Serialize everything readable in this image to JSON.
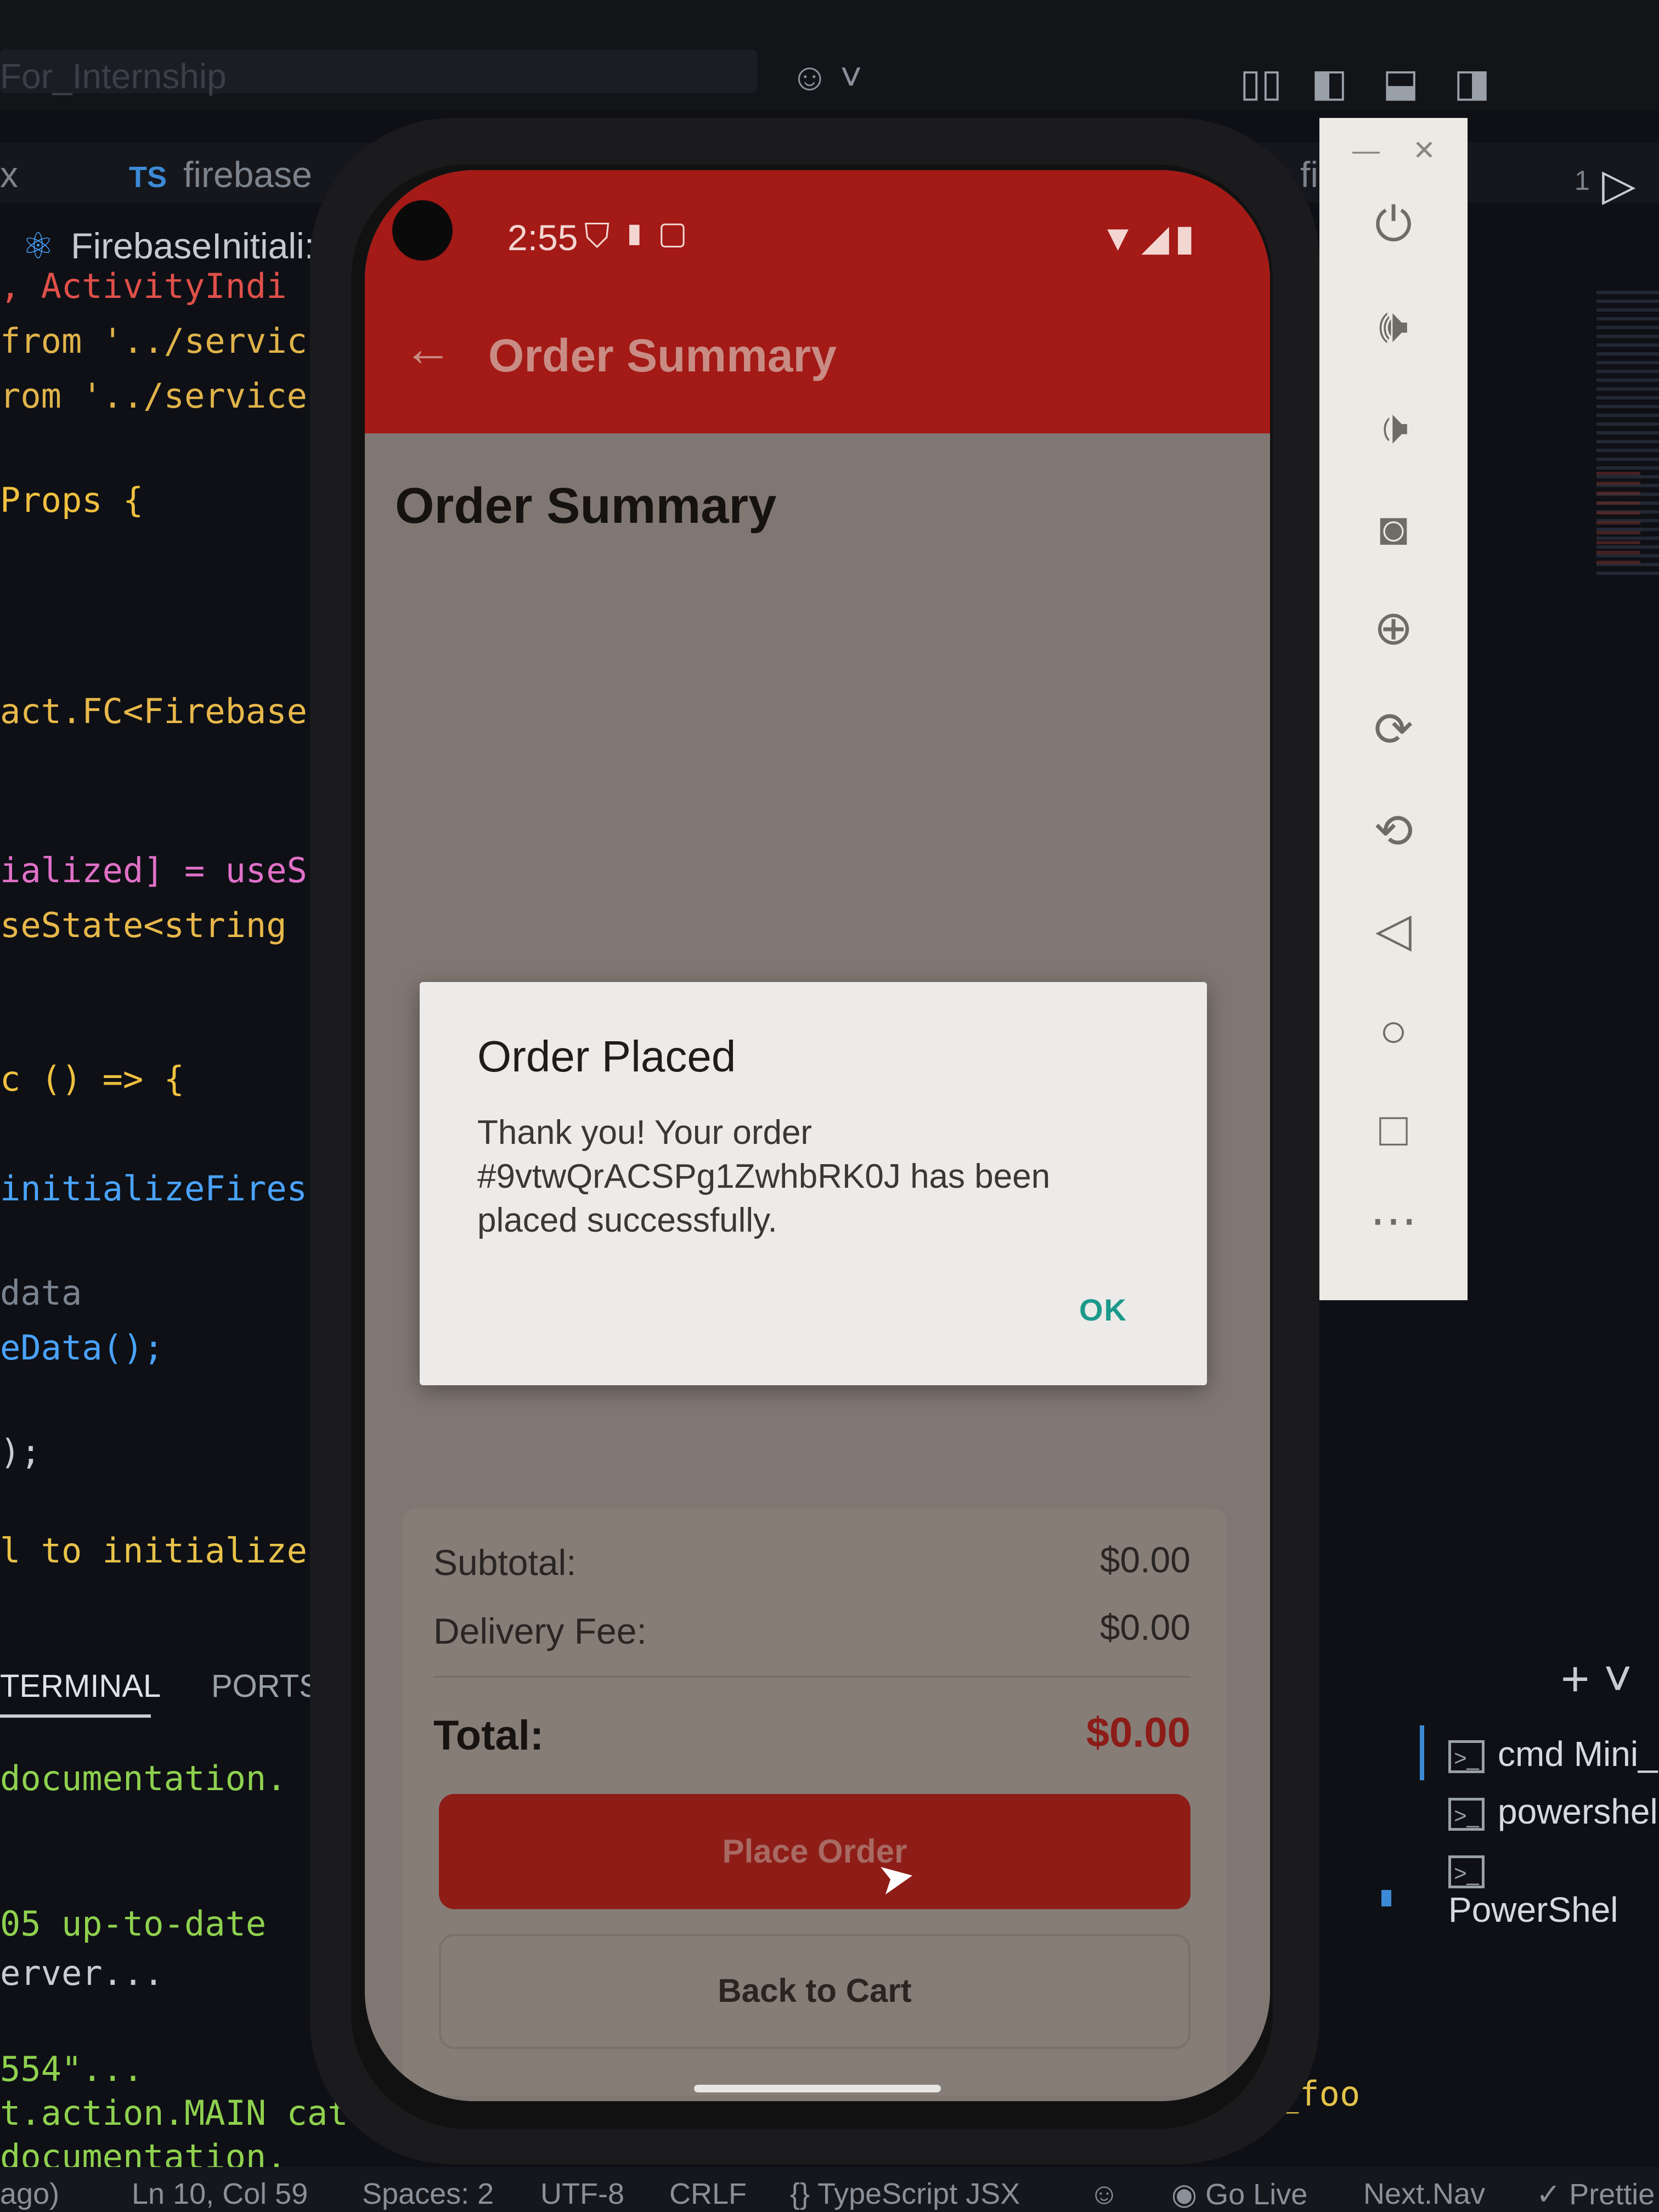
{
  "vscode": {
    "search_text": "For_Internship",
    "tab_left": "x",
    "tab_firebase": "firebase",
    "tab_fi": "fi",
    "tab_num": "1",
    "breadcrumb": "FirebaseInitiali:",
    "code_lines": [
      {
        "text": ", ActivityIndi",
        "color": "#e0504a"
      },
      {
        "text": "from '../servic",
        "color": "#e0b34a"
      },
      {
        "text": "rom '../service",
        "color": "#e0b34a"
      },
      {
        "text": "Props {",
        "color": "#f0c040"
      },
      {
        "text": "act.FC<Firebase",
        "color": "#e8b84a"
      },
      {
        "text": "ialized] = useS",
        "color": "#e070c8"
      },
      {
        "text": "seState<string",
        "color": "#e8b84a"
      },
      {
        "text": "c () => {",
        "color": "#f0c040"
      },
      {
        "text": "initializeFires",
        "color": "#4aa3ff"
      },
      {
        "text": "data",
        "color": "#7b8390"
      },
      {
        "text": "eData();",
        "color": "#4aa3ff"
      },
      {
        "text": ");",
        "color": "#c8ccd2"
      },
      {
        "text": "l to initialize",
        "color": "#e8c24a"
      }
    ],
    "panel_tabs": [
      "TERMINAL",
      "PORTS"
    ],
    "terminal_lines": [
      {
        "text": "documentation.",
        "color": "#8fd14f"
      },
      {
        "text": "05 up-to-date",
        "color": "#8fd14f"
      },
      {
        "text": "erver...",
        "color": "#c8ccd2"
      },
      {
        "text": "554\"...",
        "color": "#8fd14f"
      },
      {
        "text": "t.action.MAIN cat",
        "color": "#8fd14f"
      },
      {
        "text": "documentation.",
        "color": "#8fd14f"
      }
    ],
    "terminal_list": [
      "cmd Mini_",
      "powershel",
      "PowerShel"
    ],
    "terminal_foo": "_foo",
    "status_items": [
      "ago)",
      "Ln 10, Col 59",
      "Spaces: 2",
      "UTF-8",
      "CRLF",
      "{} TypeScript JSX",
      "Go Live",
      "Next.Nav",
      "Prettie"
    ]
  },
  "emulator_toolbar": {
    "buttons": [
      "power-icon",
      "volume-up-icon",
      "volume-down-icon",
      "camera-icon",
      "zoom-in-icon",
      "rotate-right-icon",
      "rotate-left-icon",
      "back-icon",
      "home-icon",
      "overview-icon",
      "more-icon"
    ]
  },
  "phone": {
    "status": {
      "time": "2:55"
    },
    "appbar": {
      "title": "Order Summary"
    },
    "page_title": "Order Summary",
    "summary": {
      "subtotal_label": "Subtotal:",
      "subtotal_value": "$0.00",
      "delivery_label": "Delivery Fee:",
      "delivery_value": "$0.00",
      "total_label": "Total:",
      "total_value": "$0.00"
    },
    "place_order_label": "Place Order",
    "back_to_cart_label": "Back to Cart",
    "dialog": {
      "title": "Order Placed",
      "message": "Thank you! Your order #9vtwQrACSPg1ZwhbRK0J has been placed successfully.",
      "ok_label": "OK"
    },
    "colors": {
      "primary": "#a31a16",
      "total": "#8c1c18",
      "ok": "#1b9a8c"
    }
  }
}
